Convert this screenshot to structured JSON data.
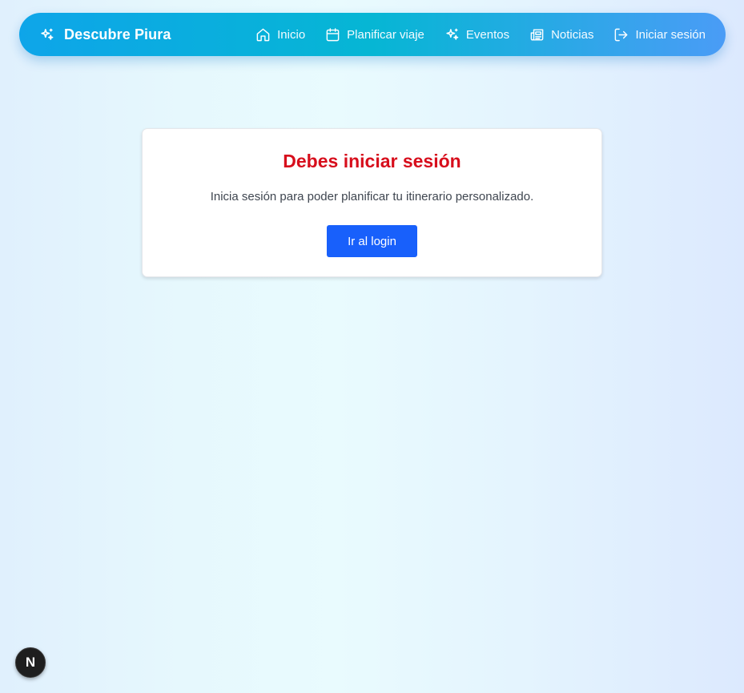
{
  "navbar": {
    "brand": {
      "icon": "sparkles-icon",
      "title": "Descubre Piura"
    },
    "links": [
      {
        "label": "Inicio",
        "icon": "home-icon"
      },
      {
        "label": "Planificar viaje",
        "icon": "calendar-icon"
      },
      {
        "label": "Eventos",
        "icon": "sparkles-icon"
      },
      {
        "label": "Noticias",
        "icon": "newspaper-icon"
      },
      {
        "label": "Iniciar sesión",
        "icon": "log-in-icon"
      }
    ]
  },
  "auth_card": {
    "title": "Debes iniciar sesión",
    "message": "Inicia sesión para poder planificar tu itinerario personalizado.",
    "button_label": "Ir al login"
  },
  "dev_badge": {
    "label": "N"
  },
  "colors": {
    "title_red": "#d70e1c",
    "button_blue": "#1860fb",
    "navbar_start": "#0ea5e9",
    "navbar_end": "#4a9cf6"
  }
}
